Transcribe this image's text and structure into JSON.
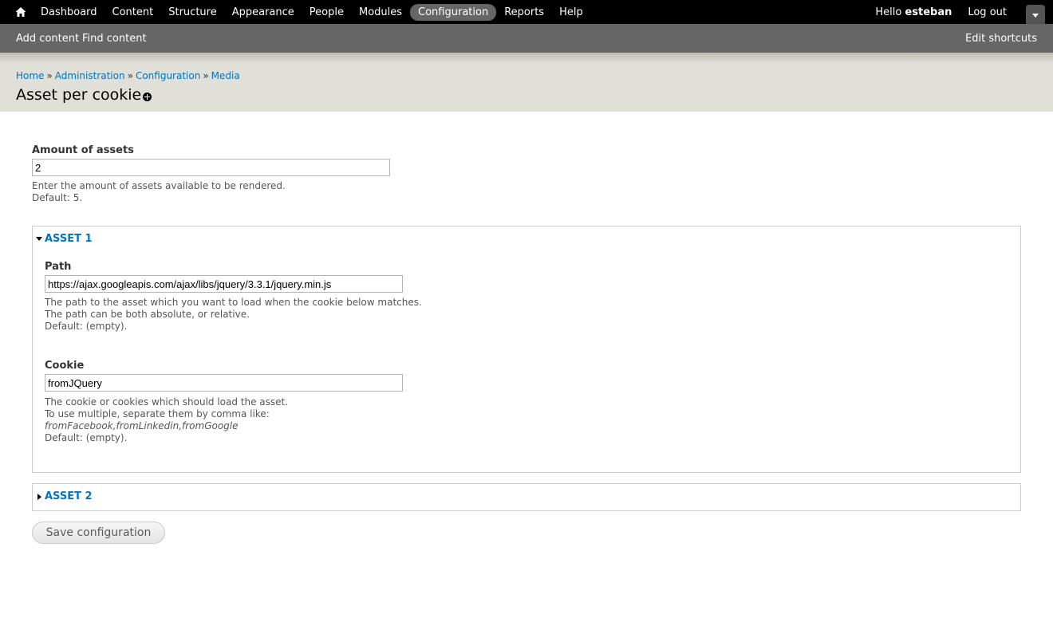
{
  "toolbar": {
    "menu": [
      "Dashboard",
      "Content",
      "Structure",
      "Appearance",
      "People",
      "Modules",
      "Configuration",
      "Reports",
      "Help"
    ],
    "active_item": "Configuration",
    "greeting": "Hello",
    "username": "esteban",
    "logout": "Log out"
  },
  "shortcuts": {
    "add_content": "Add content",
    "find_content": "Find content",
    "edit_shortcuts": "Edit shortcuts"
  },
  "breadcrumb": {
    "items": [
      "Home",
      "Administration",
      "Configuration",
      "Media"
    ],
    "separator": "»"
  },
  "page_title": "Asset per cookie",
  "form": {
    "amount": {
      "label": "Amount of assets",
      "value": "2",
      "description": [
        "Enter the amount of assets available to be rendered.",
        "Default: 5."
      ]
    },
    "asset1": {
      "legend": "Asset 1",
      "expanded": true,
      "path": {
        "label": "Path",
        "value": "https://ajax.googleapis.com/ajax/libs/jquery/3.3.1/jquery.min.js",
        "description": [
          "The path to the asset which you want to load when the cookie below matches.",
          "The path can be both absolute, or relative.",
          "Default: (empty)."
        ]
      },
      "cookie": {
        "label": "Cookie",
        "value": "fromJQuery",
        "description": [
          "The cookie or cookies which should load the asset.",
          "To use multiple, separate them by comma like:",
          "fromFacebook,fromLinkedin,fromGoogle",
          "Default: (empty)."
        ]
      }
    },
    "asset2": {
      "legend": "Asset 2",
      "expanded": false
    },
    "save_label": "Save configuration"
  },
  "colors": {
    "link": "#0074bd",
    "toolbar_bg": "#000000",
    "shortcut_bar_bg": "#666666",
    "header_bg": "#e0e0d8"
  }
}
